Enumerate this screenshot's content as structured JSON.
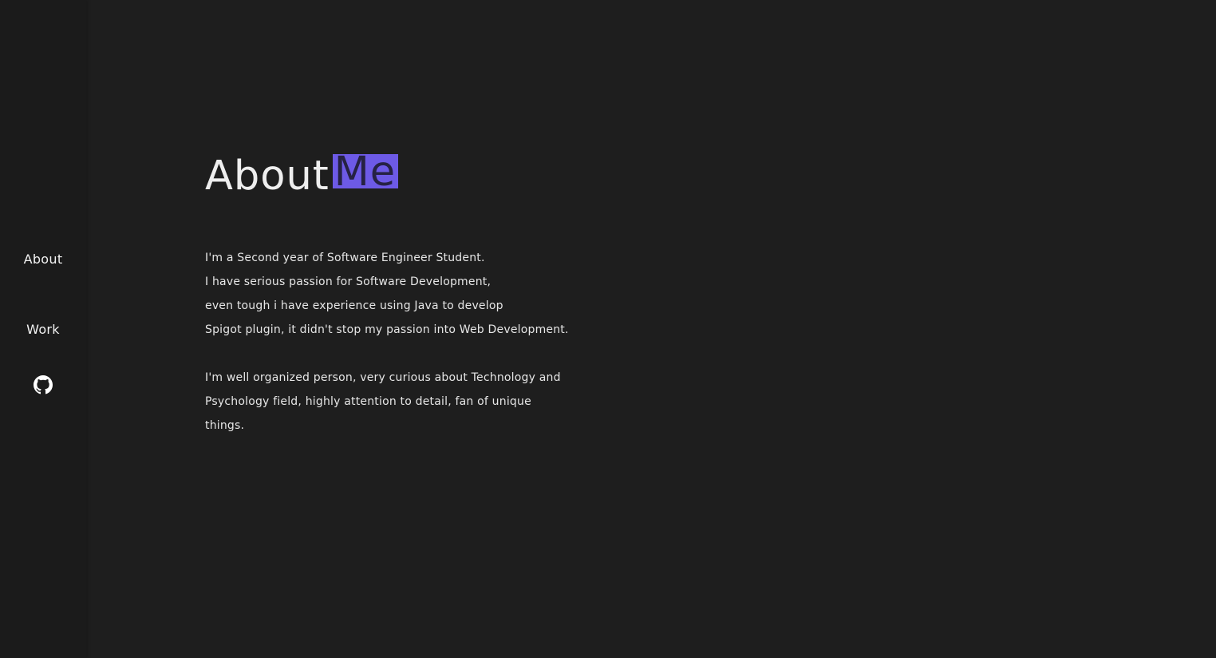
{
  "sidebar": {
    "nav": {
      "about_label": "About",
      "work_label": "Work"
    },
    "github_icon": "github-icon"
  },
  "main": {
    "title": {
      "text": "About",
      "highlight": "Me",
      "highlight_color": "#6d5ae6"
    },
    "bio": {
      "paragraph1": [
        "I'm a Second year of Software Engineer Student.",
        "I have serious passion for Software Development,",
        "even tough i have experience using Java to develop",
        "Spigot plugin, it didn't stop my passion into Web Development."
      ],
      "paragraph2": [
        "I'm well organized person, very curious about Technology and",
        "Psychology field, highly attention to detail, fan of unique",
        "things."
      ]
    }
  },
  "colors": {
    "background": "#1e1e1e",
    "sidebar": "#1b1b1b",
    "text": "#eeeeee",
    "accent": "#6d5ae6"
  }
}
